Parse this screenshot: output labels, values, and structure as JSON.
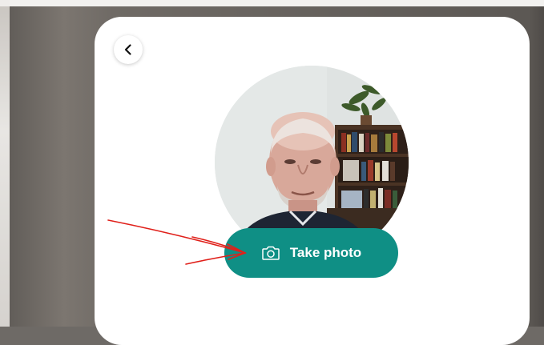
{
  "dialog": {
    "back_icon": "chevron-left-icon",
    "photo_alt": "webcam-preview",
    "take_photo": {
      "label": "Take photo",
      "icon": "camera-icon"
    }
  },
  "colors": {
    "accent": "#0f8f85",
    "card": "#ffffff",
    "annotation": "#e0201a"
  }
}
